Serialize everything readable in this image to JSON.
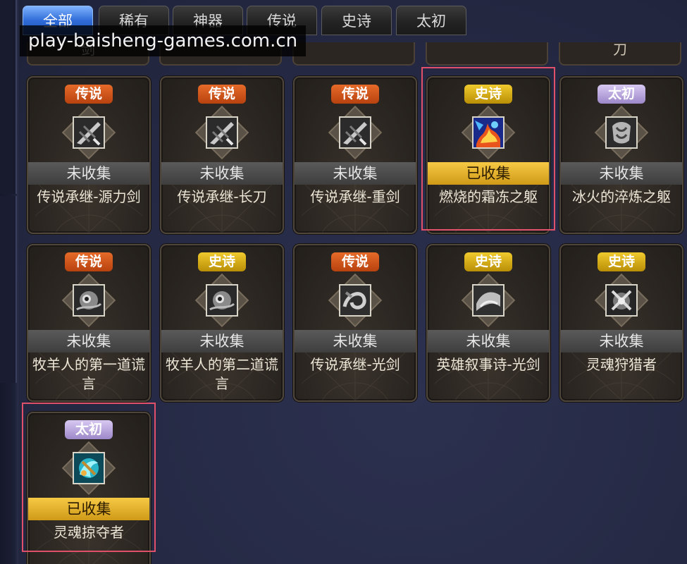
{
  "tabs": [
    {
      "label": "全部",
      "active": true
    },
    {
      "label": "稀有",
      "active": false
    },
    {
      "label": "神器",
      "active": false
    },
    {
      "label": "传说",
      "active": false
    },
    {
      "label": "史诗",
      "active": false
    },
    {
      "label": "太初",
      "active": false
    }
  ],
  "watermark": "play-baisheng-games.com.cn",
  "partial_row": [
    "剑",
    "",
    "",
    "",
    "刀"
  ],
  "cards": [
    {
      "rarity": "传说",
      "tier": "legend",
      "status": "未收集",
      "collected": false,
      "name": "传说承继-源力剑",
      "highlighted": false,
      "icon": "grey-sword-icon"
    },
    {
      "rarity": "传说",
      "tier": "legend",
      "status": "未收集",
      "collected": false,
      "name": "传说承继-长刀",
      "highlighted": false,
      "icon": "grey-blade-icon"
    },
    {
      "rarity": "传说",
      "tier": "legend",
      "status": "未收集",
      "collected": false,
      "name": "传说承继-重剑",
      "highlighted": false,
      "icon": "grey-greatsword-icon"
    },
    {
      "rarity": "史诗",
      "tier": "epic",
      "status": "已收集",
      "collected": true,
      "name": "燃烧的霜冻之躯",
      "highlighted": true,
      "icon": "fire-frost-icon"
    },
    {
      "rarity": "太初",
      "tier": "primal",
      "status": "未收集",
      "collected": false,
      "name": "冰火的淬炼之躯",
      "highlighted": false,
      "icon": "grey-armor-icon"
    },
    {
      "rarity": "传说",
      "tier": "legend",
      "status": "未收集",
      "collected": false,
      "name": "牧羊人的第一道谎言",
      "highlighted": false,
      "icon": "grey-eye-icon"
    },
    {
      "rarity": "史诗",
      "tier": "epic",
      "status": "未收集",
      "collected": false,
      "name": "牧羊人的第二道谎言",
      "highlighted": false,
      "icon": "grey-eye-icon"
    },
    {
      "rarity": "传说",
      "tier": "legend",
      "status": "未收集",
      "collected": false,
      "name": "传说承继-光剑",
      "highlighted": false,
      "icon": "grey-swirl-icon"
    },
    {
      "rarity": "史诗",
      "tier": "epic",
      "status": "未收集",
      "collected": false,
      "name": "英雄叙事诗-光剑",
      "highlighted": false,
      "icon": "grey-wave-icon"
    },
    {
      "rarity": "史诗",
      "tier": "epic",
      "status": "未收集",
      "collected": false,
      "name": "灵魂狩猎者",
      "highlighted": false,
      "icon": "grey-hunter-icon"
    },
    {
      "rarity": "太初",
      "tier": "primal",
      "status": "已收集",
      "collected": true,
      "name": "灵魂掠夺者",
      "highlighted": true,
      "icon": "cyan-soul-icon"
    }
  ],
  "colors": {
    "background": "#262b45",
    "legend_badge": "#d2591c",
    "epic_badge": "#d9ad14",
    "primal_badge": "#b9a8e0",
    "collected_bar": "#e8b52e",
    "highlight_border": "#e0506a"
  }
}
